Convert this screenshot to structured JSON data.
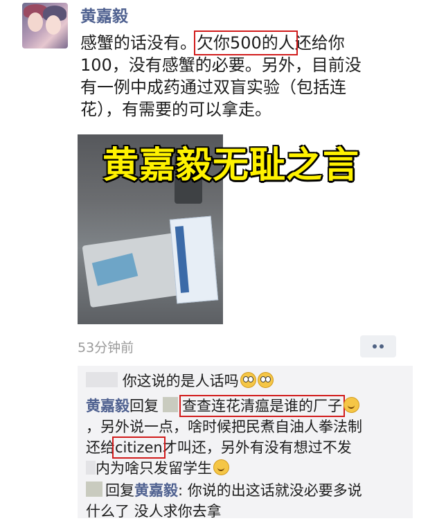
{
  "post": {
    "author": "黄嘉毅",
    "text_lines": {
      "l1a": "感蟹的话没有。",
      "l1b": "欠你500的人",
      "l1c": "还给你",
      "l2": "100，没有感蟹的必要。另外，目前没",
      "l3": "有一例中成药通过双盲实验（包括连",
      "l4": "花），有需要的可以拿走。"
    },
    "overlay_title": "黄嘉毅无耻之言",
    "time": "53分钟前"
  },
  "comments": {
    "c1": "你这说的是人话吗",
    "c2_name": "黄嘉毅",
    "c2_reply": "回复",
    "c2_hl": "查查连花清瘟是谁的厂子",
    "c2_l2": "，另外说一点，啥时候把民煮自油人拳法制",
    "c2_l3a": "还给",
    "c2_l3b": "citizen",
    "c2_l3c": "才叫还，另外有没有想过不发",
    "c2_l4": "内为啥只发留学生",
    "c3_reply": "回复",
    "c3_name": "黄嘉毅",
    "c3_text": ": 你说的出这话就没必要多说",
    "c3_l2": "什么了 没人求你去拿"
  },
  "colors": {
    "name_blue": "#4f6190",
    "highlight_red": "#d11a1a",
    "overlay_yellow": "#fff200"
  }
}
